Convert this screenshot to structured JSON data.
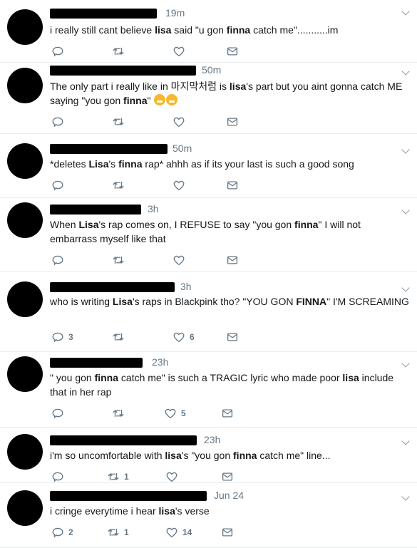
{
  "tweets": [
    {
      "time": "19m",
      "segments": [
        {
          "t": "i really still cant believe "
        },
        {
          "t": "lisa",
          "b": true
        },
        {
          "t": " said \"u gon "
        },
        {
          "t": "finna",
          "b": true
        },
        {
          "t": " catch me\"...........im"
        }
      ],
      "emoji_count": 0,
      "replies": "",
      "retweets": "",
      "likes": ""
    },
    {
      "time": "50m",
      "segments": [
        {
          "t": "The only part i really like in 마지막처럼 is "
        },
        {
          "t": "lisa",
          "b": true
        },
        {
          "t": "'s part but you aint gonna catch ME saying \"you gon "
        },
        {
          "t": "finna",
          "b": true
        },
        {
          "t": "\" "
        }
      ],
      "emoji_count": 2,
      "replies": "",
      "retweets": "",
      "likes": ""
    },
    {
      "time": "50m",
      "segments": [
        {
          "t": "*deletes "
        },
        {
          "t": "Lisa",
          "b": true
        },
        {
          "t": "'s "
        },
        {
          "t": "finna",
          "b": true
        },
        {
          "t": " rap* ahhh as if its your last is such a good song"
        }
      ],
      "emoji_count": 0,
      "replies": "",
      "retweets": "",
      "likes": ""
    },
    {
      "time": "3h",
      "segments": [
        {
          "t": "When "
        },
        {
          "t": "Lisa",
          "b": true
        },
        {
          "t": "'s rap comes on, I REFUSE to say \"you gon "
        },
        {
          "t": "finna",
          "b": true
        },
        {
          "t": "\" I will not embarrass myself like that"
        }
      ],
      "emoji_count": 0,
      "replies": "",
      "retweets": "",
      "likes": ""
    },
    {
      "time": "3h",
      "segments": [
        {
          "t": "who is writing "
        },
        {
          "t": "Lisa",
          "b": true
        },
        {
          "t": "'s raps in Blackpink tho? \"YOU GON "
        },
        {
          "t": "FINNA",
          "b": true
        },
        {
          "t": "\" I'M SCREAMING"
        }
      ],
      "emoji_count": 0,
      "replies": "3",
      "retweets": "",
      "likes": "6"
    },
    {
      "time": "23h",
      "segments": [
        {
          "t": "\" you gon "
        },
        {
          "t": "finna",
          "b": true
        },
        {
          "t": " catch me\" is such a TRAGIC lyric who made poor "
        },
        {
          "t": "lisa",
          "b": true
        },
        {
          "t": " include that in her rap"
        }
      ],
      "emoji_count": 0,
      "replies": "",
      "retweets": "",
      "likes": "5"
    },
    {
      "time": "23h",
      "segments": [
        {
          "t": "i'm so uncomfortable with "
        },
        {
          "t": "lisa",
          "b": true
        },
        {
          "t": "'s \"you gon "
        },
        {
          "t": "finna",
          "b": true
        },
        {
          "t": " catch me\" line..."
        }
      ],
      "emoji_count": 0,
      "replies": "",
      "retweets": "1",
      "likes": ""
    },
    {
      "time": "Jun 24",
      "segments": [
        {
          "t": "i cringe everytime i hear "
        },
        {
          "t": "lisa",
          "b": true
        },
        {
          "t": "'s verse"
        }
      ],
      "emoji_count": 0,
      "replies": "2",
      "retweets": "1",
      "likes": "14"
    }
  ],
  "icons": [
    "reply-icon",
    "retweet-icon",
    "like-icon",
    "message-icon",
    "caret-down-icon"
  ],
  "colors": {
    "text": "#14171a",
    "muted": "#657786",
    "divider": "#e6ecf0",
    "emoji": "#f5b82e"
  }
}
